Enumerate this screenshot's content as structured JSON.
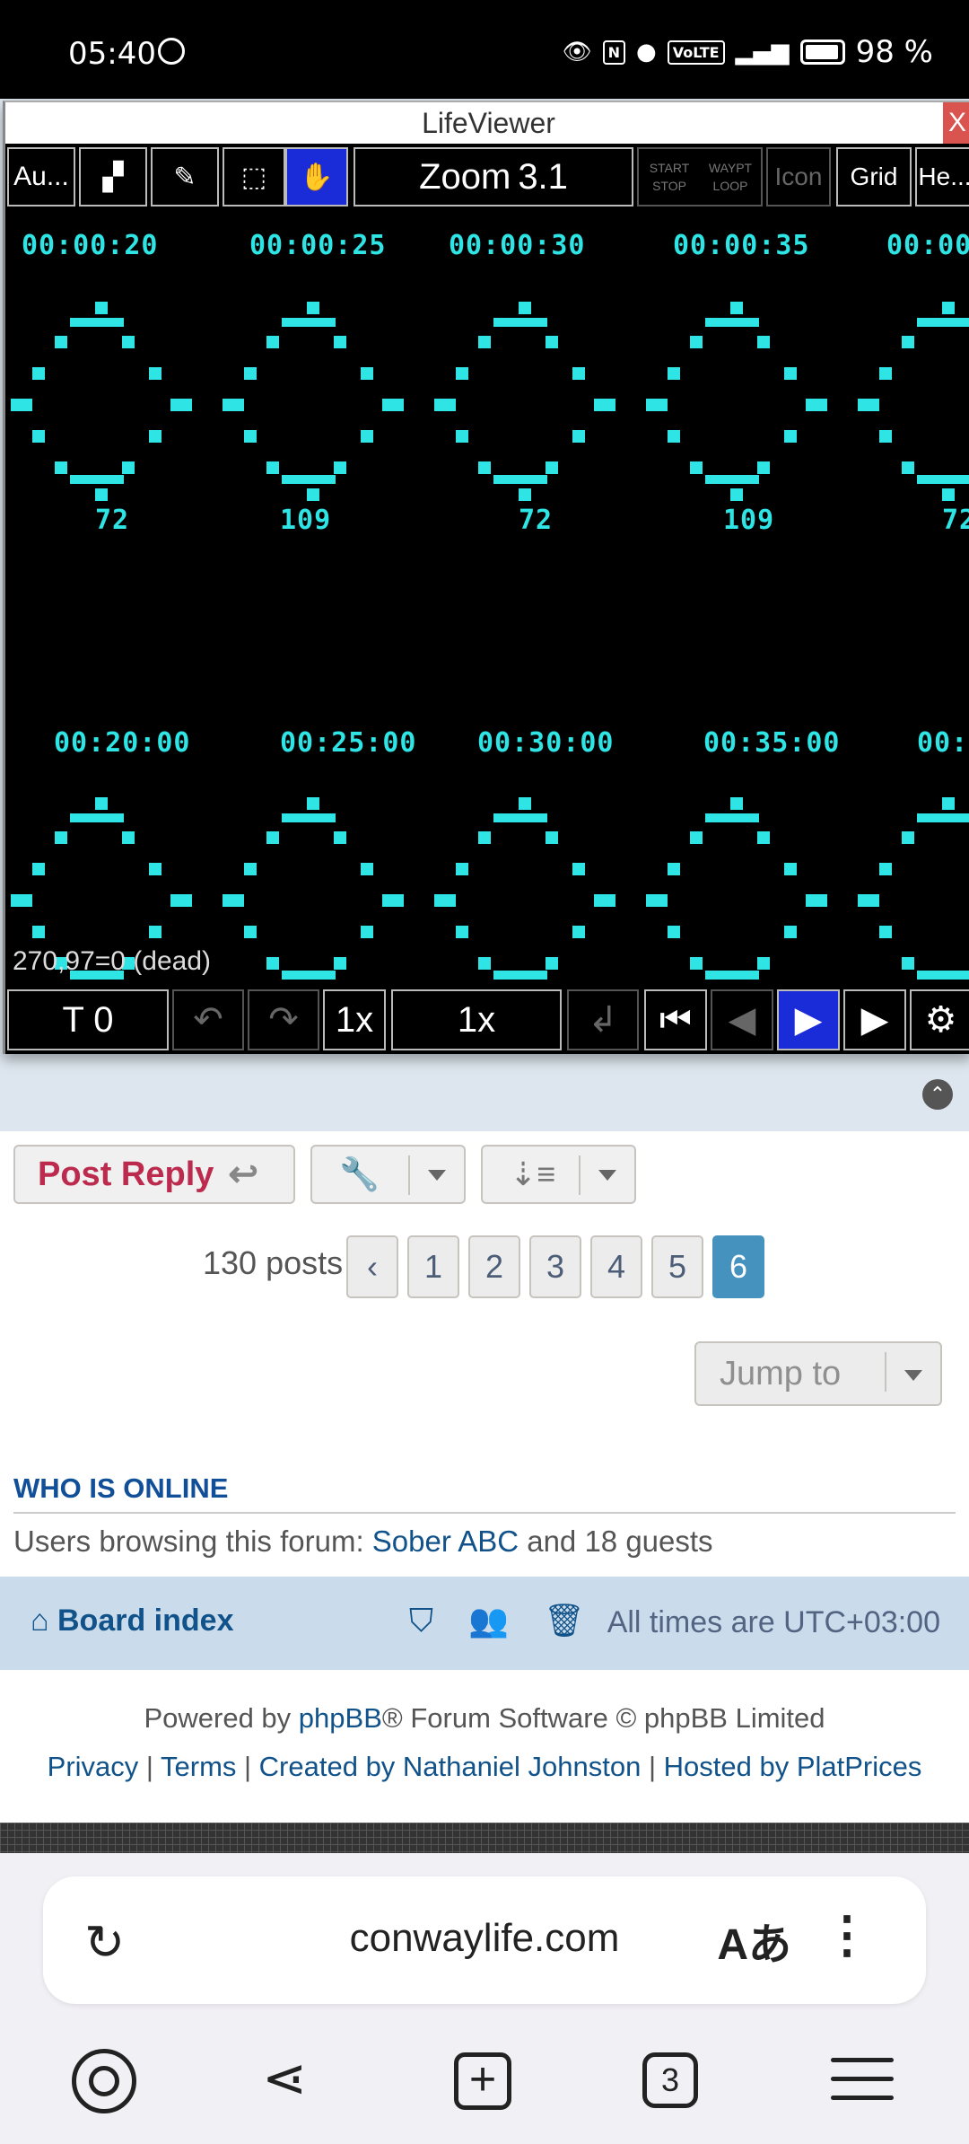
{
  "status_bar": {
    "time": "05:40",
    "battery": "98 %"
  },
  "lifeviewer": {
    "title": "LifeViewer",
    "close": "X",
    "toolbar": {
      "autofit": "Au...",
      "zoom_label": "Zoom",
      "zoom_value": "3.1",
      "start": "START",
      "waypt": "WAYPT",
      "stop": "STOP",
      "loop": "LOOP",
      "icon": "Icon",
      "grid": "Grid",
      "help": "He..."
    },
    "row1_times": [
      "00:00:20",
      "00:00:25",
      "00:00:30",
      "00:00:35",
      "00:00"
    ],
    "row1_numbers": [
      "72",
      "109",
      "72",
      "109",
      "72"
    ],
    "row2_times": [
      "00:20:00",
      "00:25:00",
      "00:30:00",
      "00:35:00",
      "00:"
    ],
    "status": "270,97=0 (dead)",
    "bottom": {
      "gen": "T 0",
      "speed1": "1x",
      "speed2": "1x"
    }
  },
  "forum": {
    "post_reply": "Post Reply",
    "posts_count": "130 posts",
    "pages": [
      "1",
      "2",
      "3",
      "4",
      "5",
      "6"
    ],
    "active_page": "6",
    "jump_to": "Jump to",
    "who_is_online": "WHO IS ONLINE",
    "online_prefix": "Users browsing this forum: ",
    "online_user": "Sober ABC",
    "online_suffix": " and 18 guests",
    "board_index": "Board index",
    "timezone": "All times are UTC+03:00",
    "powered_prefix": "Powered by ",
    "phpbb": "phpBB",
    "powered_suffix": "® Forum Software © phpBB Limited",
    "footer_links": [
      "Privacy",
      "Terms",
      "Created by Nathaniel Johnston",
      "Hosted by PlatPrices"
    ],
    "separator": " | "
  },
  "browser": {
    "url": "conwaylife.com",
    "tabs": "3"
  }
}
